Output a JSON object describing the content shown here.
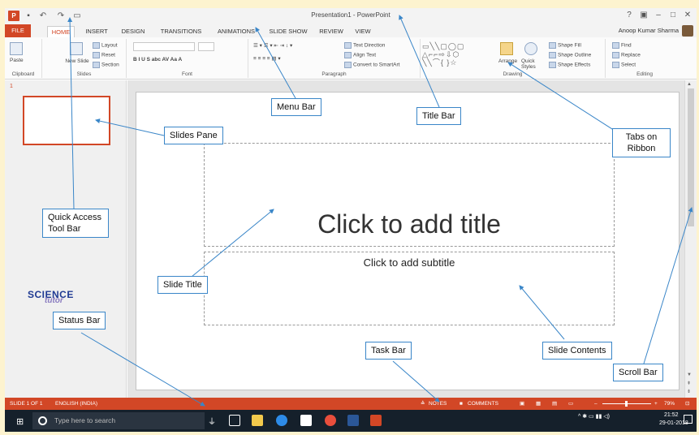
{
  "window": {
    "title": "Presentation1 - PowerPoint",
    "controls": [
      "?",
      "▣",
      "–",
      "□",
      "✕"
    ],
    "user": "Anoop Kumar Sharma"
  },
  "menu": {
    "tabs": [
      "FILE",
      "HOME",
      "INSERT",
      "DESIGN",
      "TRANSITIONS",
      "ANIMATIONS",
      "SLIDE SHOW",
      "REVIEW",
      "VIEW"
    ],
    "active": "HOME"
  },
  "ribbon": {
    "clipboard": {
      "paste": "Paste",
      "label": "Clipboard"
    },
    "slides": {
      "new_slide": "New Slide",
      "layout": "Layout",
      "reset": "Reset",
      "section": "Section",
      "label": "Slides"
    },
    "font": {
      "label": "Font",
      "buttons": "B  I  U  S  abc  AV  Aa  A"
    },
    "paragraph": {
      "text_direction": "Text Direction",
      "align_text": "Align Text",
      "convert": "Convert to SmartArt",
      "label": "Paragraph"
    },
    "drawing": {
      "arrange": "Arrange",
      "quick_styles": "Quick Styles",
      "shape_fill": "Shape Fill",
      "shape_outline": "Shape Outline",
      "shape_effects": "Shape Effects",
      "label": "Drawing"
    },
    "editing": {
      "find": "Find",
      "replace": "Replace",
      "select": "Select",
      "label": "Editing"
    }
  },
  "slides_pane": {
    "slide_number": "1"
  },
  "slide": {
    "title_placeholder": "Click to add title",
    "subtitle_placeholder": "Click to add subtitle"
  },
  "status_bar": {
    "slide_info": "SLIDE 1 OF 1",
    "language": "ENGLISH (INDIA)",
    "notes": "NOTES",
    "comments": "COMMENTS",
    "zoom": "79%"
  },
  "taskbar": {
    "search_placeholder": "Type here to search",
    "time": "21:52",
    "date": "29-01-2018"
  },
  "logo": {
    "science": "SCIENCE",
    "tutor": "tutor"
  },
  "callouts": {
    "menu_bar": "Menu Bar",
    "title_bar": "Title Bar",
    "slides_pane": "Slides Pane",
    "tabs_on_ribbon": "Tabs on Ribbon",
    "quick_access": "Quick Access Tool Bar",
    "slide_title": "Slide Title",
    "status_bar": "Status Bar",
    "task_bar": "Task Bar",
    "slide_contents": "Slide Contents",
    "scroll_bar": "Scroll Bar"
  },
  "colors": {
    "accent": "#d24726",
    "callout_border": "#3a86c8",
    "background": "#fdf3cf"
  }
}
